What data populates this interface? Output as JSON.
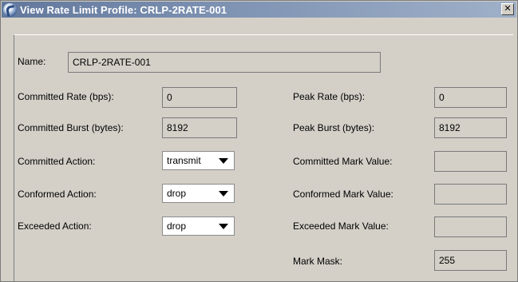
{
  "window": {
    "title": "View Rate Limit Profile: CRLP-2RATE-001",
    "title_icon": "globe-icon",
    "close_icon": "close-icon",
    "close_glyph": "✕"
  },
  "name": {
    "label": "Name:",
    "value": "CRLP-2RATE-001"
  },
  "left": {
    "committed_rate": {
      "label": "Committed Rate (bps):",
      "value": "0"
    },
    "committed_burst": {
      "label": "Committed Burst (bytes):",
      "value": "8192"
    },
    "committed_action": {
      "label": "Committed Action:",
      "value": "transmit"
    },
    "conformed_action": {
      "label": "Conformed Action:",
      "value": "drop"
    },
    "exceeded_action": {
      "label": "Exceeded Action:",
      "value": "drop"
    }
  },
  "right": {
    "peak_rate": {
      "label": "Peak Rate (bps):",
      "value": "0"
    },
    "peak_burst": {
      "label": "Peak Burst (bytes):",
      "value": "8192"
    },
    "committed_mark_value": {
      "label": "Committed Mark Value:",
      "value": ""
    },
    "conformed_mark_value": {
      "label": "Conformed Mark Value:",
      "value": ""
    },
    "exceeded_mark_value": {
      "label": "Exceeded Mark Value:",
      "value": ""
    },
    "mark_mask": {
      "label": "Mark Mask:",
      "value": "255"
    }
  }
}
